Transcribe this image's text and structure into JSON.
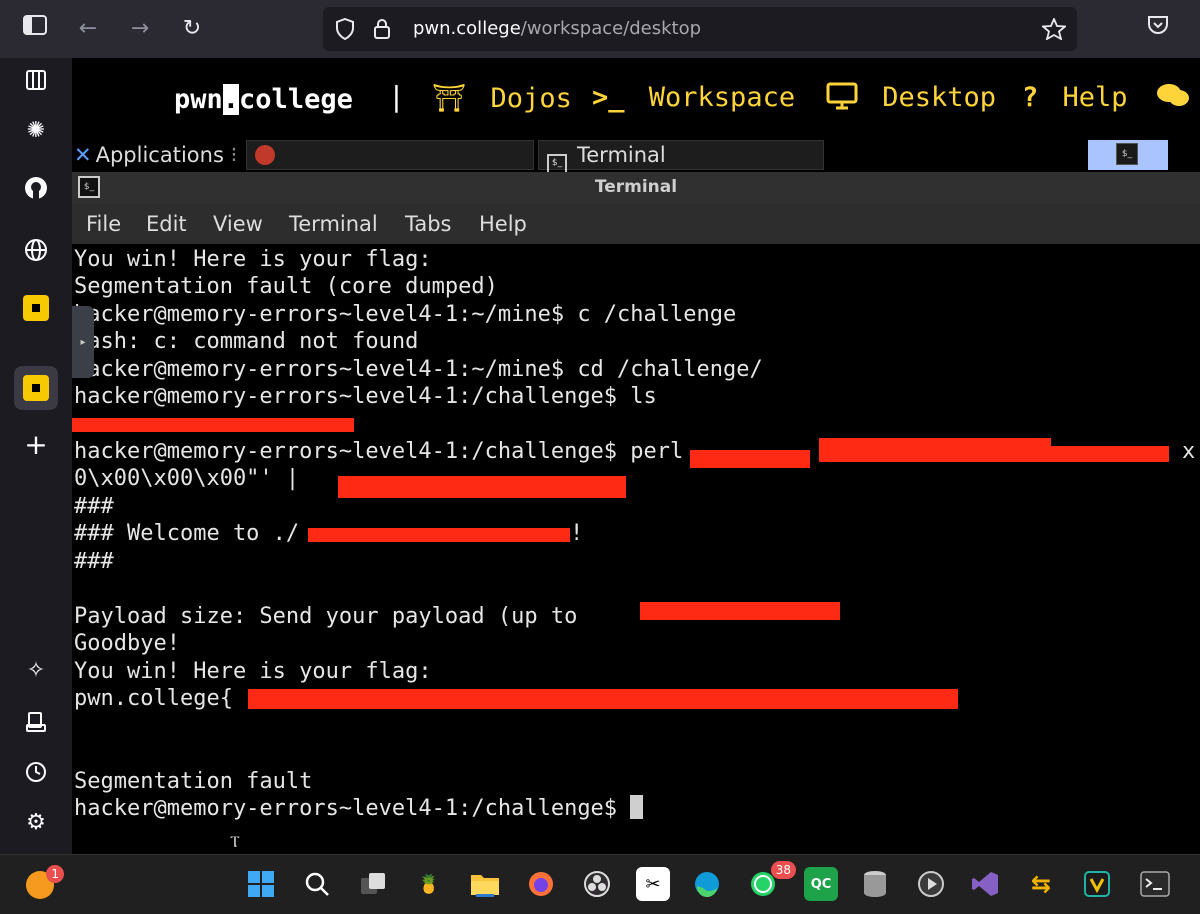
{
  "browser": {
    "url_host": "pwn.college",
    "url_path": "/workspace/desktop"
  },
  "site_nav": {
    "logo_pre": "pwn",
    "logo_dot": ".",
    "logo_post": "college",
    "separator": "|",
    "items": [
      {
        "icon": "torii-icon",
        "glyph": "⛩",
        "label": "Dojos"
      },
      {
        "icon": "prompt-icon",
        "glyph": ">_",
        "label": "Workspace"
      },
      {
        "icon": "monitor-icon",
        "glyph": "🖵",
        "label": "Desktop"
      },
      {
        "icon": "question-icon",
        "glyph": "?",
        "label": "Help"
      },
      {
        "icon": "chat-icon",
        "glyph": "💬",
        "label": ""
      }
    ]
  },
  "desktop_panel": {
    "applications": "Applications",
    "window_terminal": "Terminal"
  },
  "terminal": {
    "title": "Terminal",
    "menu": [
      "File",
      "Edit",
      "View",
      "Terminal",
      "Tabs",
      "Help"
    ],
    "lines": [
      "You win! Here is your flag:",
      "Segmentation fault (core dumped)",
      "hacker@memory-errors~level4-1:~/mine$ c /challenge",
      "bash: c: command not found",
      "hacker@memory-errors~level4-1:~/mine$ cd /challenge/",
      "hacker@memory-errors~level4-1:/challenge$ ls",
      "",
      "hacker@memory-errors~level4-1:/challenge$ perl",
      "0\\x00\\x00\\x00\"' |",
      "###",
      "### Welcome to ./",
      "###",
      "",
      "Payload size: Send your payload (up to",
      "Goodbye!",
      "You win! Here is your flag:",
      "pwn.college{",
      "",
      "",
      "Segmentation fault",
      "hacker@memory-errors~level4-1:/challenge$ "
    ],
    "trailing_x": "x",
    "welcome_suffix": "!"
  },
  "taskbar": {
    "firefox_badge": "1",
    "whatsapp_badge": "38"
  },
  "colors": {
    "nav_accent": "#ffd43b",
    "redaction": "#ff2a14"
  }
}
